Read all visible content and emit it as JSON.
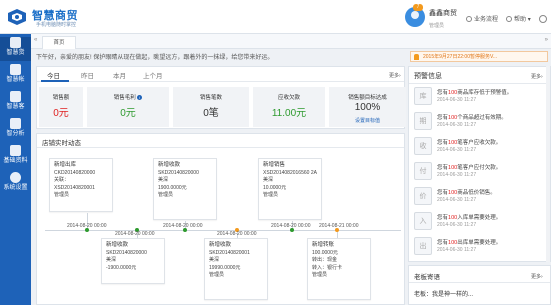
{
  "app": {
    "title": "智慧商贸",
    "subtitle": "手机电脑随时掌控"
  },
  "user": {
    "name": "鑫鑫商贸",
    "role": "管理员",
    "badge": "7"
  },
  "top_links": {
    "business": "业务流程",
    "help": "帮助"
  },
  "sidebar": {
    "items": [
      {
        "label": "智慧货"
      },
      {
        "label": "智慧帐"
      },
      {
        "label": "智慧客"
      },
      {
        "label": "智分析"
      },
      {
        "label": "基础资料"
      },
      {
        "label": "系统设置"
      }
    ]
  },
  "tabs": {
    "home": "首页"
  },
  "greeting": "下午好，亲爱的朋友! 保护眼睛从现在做起，眺望远方，跟着外的一抹绿，给您带来好运。",
  "notice": "2015年9月27日22:00暂停服务V...",
  "stats": {
    "periods": [
      "今日",
      "昨日",
      "本月",
      "上个月"
    ],
    "more": "更多›",
    "kpis": [
      {
        "label": "销售额",
        "value": "0元",
        "color": "#e02020"
      },
      {
        "label": "销售毛利",
        "value": "0元",
        "color": "#2e9a2e",
        "info": "i"
      },
      {
        "label": "销售笔数",
        "value": "0笔",
        "color": "#333333"
      },
      {
        "label": "应收欠款",
        "value": "11.00元",
        "color": "#2e9a2e"
      },
      {
        "label": "销售额目标达成",
        "value": "100%",
        "color": "#333333",
        "sub": "设置目标值"
      }
    ]
  },
  "dynamics": {
    "title": "店铺实时动态",
    "top_cards": [
      {
        "title": "新增出库",
        "lines": [
          "CKD20140820000",
          "关联：XSD20140820001",
          "管理员"
        ]
      },
      {
        "title": "新增收款",
        "lines": [
          "SKD20140820000",
          "美深",
          "1900.0000元",
          "管理员"
        ]
      },
      {
        "title": "新增销售",
        "lines": [
          "XSD2014082016560 2A",
          "美深",
          "10.0000元",
          "管理员"
        ]
      }
    ],
    "bottom_cards": [
      {
        "title": "新增收款",
        "lines": [
          "SKD20140820000",
          "美深",
          "-1900.0000元"
        ]
      },
      {
        "title": "新增收款",
        "lines": [
          "SKD20140820001",
          "美深",
          "19990.0000元",
          "管理员"
        ]
      },
      {
        "title": "新增转账",
        "lines": [
          "100.0000元",
          "转出：现金",
          "转入：银行卡",
          "管理员"
        ]
      }
    ],
    "dates": [
      "2014-08-20 00:00",
      "2014-08-20 00:00",
      "2014-08-20 00:00",
      "2014-08-20 00:00",
      "2014-08-20 00:00",
      "2014-08-21 00:00"
    ]
  },
  "warnings": {
    "title": "预警信息",
    "more": "更多›",
    "items": [
      {
        "pre": "您有",
        "num": "100",
        "post": "商品库存低于预警值。",
        "date": "2014-06-30 11:27",
        "icon": "库"
      },
      {
        "pre": "您有",
        "num": "100",
        "post": "个商品超过有效期。",
        "date": "2014-06-30 11:27",
        "icon": "期"
      },
      {
        "pre": "您有",
        "num": "100",
        "post": "笔客户应收欠款。",
        "date": "2014-06-30 11:27",
        "icon": "收"
      },
      {
        "pre": "您有",
        "num": "100",
        "post": "笔客户应付欠款。",
        "date": "2014-06-30 11:27",
        "icon": "付"
      },
      {
        "pre": "您有",
        "num": "100",
        "post": "商品低价销售。",
        "date": "2014-06-30 11:27",
        "icon": "价"
      },
      {
        "pre": "您有",
        "num": "100",
        "post": "入库单需要处理。",
        "date": "2014-06-30 11:27",
        "icon": "入"
      },
      {
        "pre": "您有",
        "num": "100",
        "post": "出库单需要处理。",
        "date": "2014-06-30 11:27",
        "icon": "出"
      }
    ]
  },
  "boss": {
    "title": "老板寄语",
    "more": "更多›",
    "text": "老板：我是神一样的..."
  }
}
